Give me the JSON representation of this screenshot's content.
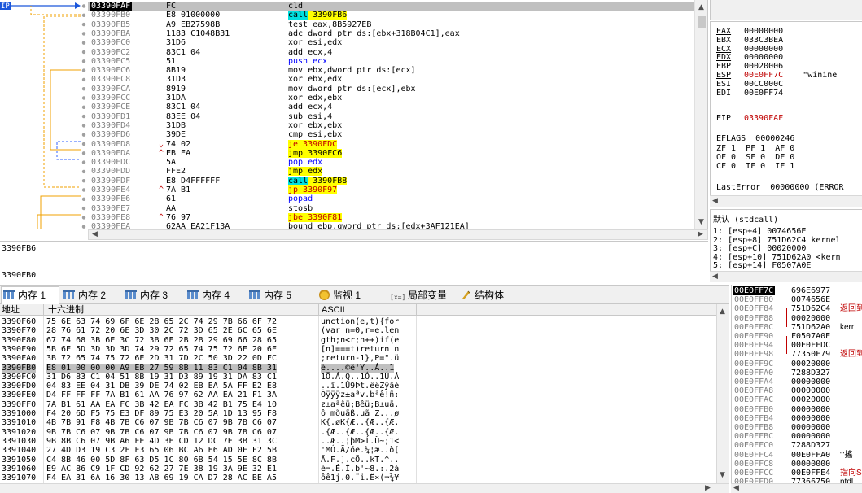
{
  "disasm": {
    "ip_label": "IP",
    "rows": [
      {
        "addr": "03390FAF",
        "arrow": "",
        "bytes": "FC",
        "asm": [
          {
            "t": "cld",
            "c": "mn"
          }
        ],
        "selected": true
      },
      {
        "addr": "03390FB0",
        "arrow": "",
        "bytes": "E8 01000000",
        "asm": [
          {
            "t": "call",
            "c": "call"
          },
          {
            "t": " 3390FB6",
            "c": "callt"
          }
        ],
        "selected": false
      },
      {
        "addr": "03390FB5",
        "arrow": "",
        "bytes": "A9 EB27598B",
        "asm": [
          {
            "t": "test eax,8B5927EB",
            "c": "mn"
          }
        ]
      },
      {
        "addr": "03390FBA",
        "arrow": "",
        "bytes": "1183 C1048B31",
        "asm": [
          {
            "t": "adc dword ptr ds:[ebx+318B04C1],eax",
            "c": "mn"
          }
        ]
      },
      {
        "addr": "03390FC0",
        "arrow": "",
        "bytes": "31D6",
        "asm": [
          {
            "t": "xor esi,edx",
            "c": "mn"
          }
        ]
      },
      {
        "addr": "03390FC2",
        "arrow": "",
        "bytes": "83C1 04",
        "asm": [
          {
            "t": "add ecx,4",
            "c": "mn"
          }
        ]
      },
      {
        "addr": "03390FC5",
        "arrow": "",
        "bytes": "51",
        "asm": [
          {
            "t": "push ecx",
            "c": "push"
          }
        ]
      },
      {
        "addr": "03390FC6",
        "arrow": "",
        "bytes": "8B19",
        "asm": [
          {
            "t": "mov ebx,dword ptr ds:[ecx]",
            "c": "mn"
          }
        ]
      },
      {
        "addr": "03390FC8",
        "arrow": "",
        "bytes": "31D3",
        "asm": [
          {
            "t": "xor ebx,edx",
            "c": "mn"
          }
        ]
      },
      {
        "addr": "03390FCA",
        "arrow": "",
        "bytes": "8919",
        "asm": [
          {
            "t": "mov dword ptr ds:[ecx],ebx",
            "c": "mn"
          }
        ]
      },
      {
        "addr": "03390FCC",
        "arrow": "",
        "bytes": "31DA",
        "asm": [
          {
            "t": "xor edx,ebx",
            "c": "mn"
          }
        ]
      },
      {
        "addr": "03390FCE",
        "arrow": "",
        "bytes": "83C1 04",
        "asm": [
          {
            "t": "add ecx,4",
            "c": "mn"
          }
        ]
      },
      {
        "addr": "03390FD1",
        "arrow": "",
        "bytes": "83EE 04",
        "asm": [
          {
            "t": "sub esi,4",
            "c": "mn"
          }
        ]
      },
      {
        "addr": "03390FD4",
        "arrow": "",
        "bytes": "31DB",
        "asm": [
          {
            "t": "xor ebx,ebx",
            "c": "mn"
          }
        ]
      },
      {
        "addr": "03390FD6",
        "arrow": "",
        "bytes": "39DE",
        "asm": [
          {
            "t": "cmp esi,ebx",
            "c": "mn"
          }
        ]
      },
      {
        "addr": "03390FD8",
        "arrow": "⌄",
        "bytes": "74 02",
        "asm": [
          {
            "t": "je 3390FDC",
            "c": "cond"
          }
        ]
      },
      {
        "addr": "03390FDA",
        "arrow": "^",
        "bytes": "EB EA",
        "asm": [
          {
            "t": "jmp 3390FC6",
            "c": "jmp"
          }
        ]
      },
      {
        "addr": "03390FDC",
        "arrow": "",
        "bytes": "5A",
        "asm": [
          {
            "t": "pop edx",
            "c": "pop"
          }
        ]
      },
      {
        "addr": "03390FDD",
        "arrow": "",
        "bytes": "FFE2",
        "asm": [
          {
            "t": "jmp edx",
            "c": "jmp"
          }
        ]
      },
      {
        "addr": "03390FDF",
        "arrow": "",
        "bytes": "E8 D4FFFFFF",
        "asm": [
          {
            "t": "call",
            "c": "call"
          },
          {
            "t": " 3390FB8",
            "c": "callt"
          }
        ]
      },
      {
        "addr": "03390FE4",
        "arrow": "^",
        "bytes": "7A B1",
        "asm": [
          {
            "t": "jp 3390F97",
            "c": "cond"
          }
        ]
      },
      {
        "addr": "03390FE6",
        "arrow": "",
        "bytes": "61",
        "asm": [
          {
            "t": "popad",
            "c": "pop"
          }
        ]
      },
      {
        "addr": "03390FE7",
        "arrow": "",
        "bytes": "AA",
        "asm": [
          {
            "t": "stosb",
            "c": "mn"
          }
        ]
      },
      {
        "addr": "03390FE8",
        "arrow": "^",
        "bytes": "76 97",
        "asm": [
          {
            "t": "jbe 3390F81",
            "c": "cond"
          }
        ]
      },
      {
        "addr": "03390FEA",
        "arrow": "",
        "bytes": "62AA EA21F13A",
        "asm": [
          {
            "t": "bound ebp,qword ptr ds:[edx+3AF121EA]",
            "c": "mn"
          }
        ]
      }
    ]
  },
  "info": {
    "line1": "3390FB6",
    "line2": "3390FB0"
  },
  "registers": {
    "rows": [
      {
        "name": "EAX",
        "value": "00000000",
        "style": "ul"
      },
      {
        "name": "EBX",
        "value": "033C3BEA",
        "style": ""
      },
      {
        "name": "ECX",
        "value": "00000000",
        "style": "ul"
      },
      {
        "name": "EDX",
        "value": "00000000",
        "style": "ul"
      },
      {
        "name": "EBP",
        "value": "00020006",
        "style": ""
      },
      {
        "name": "ESP",
        "value": "00E0FF7C",
        "style": "ulred",
        "note": "\"winine"
      },
      {
        "name": "ESI",
        "value": "00CC000C",
        "style": ""
      },
      {
        "name": "EDI",
        "value": "00E0FF74",
        "style": ""
      }
    ],
    "eip_name": "EIP",
    "eip_value": "03390FAF",
    "eflags_name": "EFLAGS",
    "eflags_value": "00000246",
    "flags": [
      "ZF 1  PF 1  AF 0",
      "OF 0  SF 0  DF 0",
      "CF 0  TF 0  IF 1"
    ],
    "lasterror": "LastError  00000000 (ERROR"
  },
  "callstack": {
    "title": "默认 (stdcall)",
    "rows": [
      "1: [esp+4] 0074656E",
      "2: [esp+8] 751D62C4 kernel",
      "3: [esp+C] 00020000",
      "4: [esp+10] 751D62A0 <kern",
      "5: [esp+14] F0507A0E"
    ]
  },
  "tabs": [
    {
      "label": "内存 1",
      "icon": "mem",
      "active": true
    },
    {
      "label": "内存 2",
      "icon": "mem"
    },
    {
      "label": "内存 3",
      "icon": "mem"
    },
    {
      "label": "内存 4",
      "icon": "mem"
    },
    {
      "label": "内存 5",
      "icon": "mem"
    },
    {
      "label": "监视 1",
      "icon": "watch"
    },
    {
      "label": "局部变量",
      "icon": "var",
      "iconText": "[x=]"
    },
    {
      "label": "结构体",
      "icon": "struct"
    }
  ],
  "dump": {
    "col_addr": "地址",
    "col_hex": "十六进制",
    "col_ascii": "ASCII",
    "rows": [
      {
        "addr": "3390F60",
        "hex": "75 6E 63 74 69 6F 6E 28 65 2C 74 29 7B 66 6F 72",
        "ascii": "unction(e,t){for"
      },
      {
        "addr": "3390F70",
        "hex": "28 76 61 72 20 6E 3D 30 2C 72 3D 65 2E 6C 65 6E",
        "ascii": "(var n=0,r=e.len"
      },
      {
        "addr": "3390F80",
        "hex": "67 74 68 3B 6E 3C 72 3B 6E 2B 2B 29 69 66 28 65",
        "ascii": "gth;n<r;n++)if(e"
      },
      {
        "addr": "3390F90",
        "hex": "5B 6E 5D 3D 3D 3D 74 29 72 65 74 75 72 6E 20 6E",
        "ascii": "[n]===t)return n"
      },
      {
        "addr": "3390FA0",
        "hex": "3B 72 65 74 75 72 6E 2D 31 7D 2C 50 3D 22 0D FC",
        "ascii": ";return-1},P=\".ü"
      },
      {
        "addr": "3390FB0",
        "hex": "E8 01 00 00 00 A9 EB 27 59 8B 11 83 C1 04 8B 31",
        "ascii": "è....©ë'Y..Á..1",
        "selected": true
      },
      {
        "addr": "3390FC0",
        "hex": "31 D6 83 C1 04 51 8B 19 31 D3 89 19 31 DA 83 C1",
        "ascii": "1Ö.Á.Q..1Ó..1Ú.Á"
      },
      {
        "addr": "3390FD0",
        "hex": "04 83 EE 04 31 DB 39 DE 74 02 EB EA 5A FF E2 E8",
        "ascii": "..î.1Û9Þt.ëêZÿâè"
      },
      {
        "addr": "3390FE0",
        "hex": "D4 FF FF FF 7A B1 61 AA 76 97 62 AA EA 21 F1 3A",
        "ascii": "Ôÿÿÿz±aªv.bªê!ñ:"
      },
      {
        "addr": "3390FF0",
        "hex": "7A B1 61 AA EA FC 3B 42 EA FC 3B 42 B1 75 E4 10",
        "ascii": "z±aªêü;Bêü;B±uä."
      },
      {
        "addr": "3391000",
        "hex": "F4 20 6D F5 75 E3 DF 89 75 E3 20 5A 1D 13 95 F8",
        "ascii": "ô mõuãß.uã Z...ø"
      },
      {
        "addr": "3391010",
        "hex": "4B 7B 91 F8 4B 7B C6 07 9B 7B C6 07 9B 7B C6 07",
        "ascii": "K{.øK{Æ..{Æ..{Æ."
      },
      {
        "addr": "3391020",
        "hex": "9B 7B C6 07 9B 7B C6 07 9B 7B C6 07 9B 7B C6 07",
        "ascii": ".{Æ..{Æ..{Æ..{Æ."
      },
      {
        "addr": "3391030",
        "hex": "9B 8B C6 07 9B A6 FE 4D 3E CD 12 DC 7E 3B 31 3C",
        "ascii": "..Æ..¦þM>Í.Ü~;1<"
      },
      {
        "addr": "3391040",
        "hex": "27 4D D3 19 C3 2F F3 65 06 BC A6 E6 AD 0F F2 5B",
        "ascii": "'MÓ.Ã/óe.¼¦æ..ò["
      },
      {
        "addr": "3391050",
        "hex": "C4 8B 46 00 5D 8F 63 D5 1C 80 6B 54 15 5E 8C 8B",
        "ascii": "Ä.F.].cÕ..kT.^.."
      },
      {
        "addr": "3391060",
        "hex": "E9 AC 86 C9 1F CD 92 62 27 7E 38 19 3A 9E 32 E1",
        "ascii": "é¬.É.Í.b'~8.:.2á"
      },
      {
        "addr": "3391070",
        "hex": "F4 EA 31 6A 16 30 13 A8 69 19 CA D7 28 AC BE A5",
        "ascii": "ôê1j.0.¨i.Ê×(¬¾¥"
      }
    ]
  },
  "stack": {
    "rows": [
      {
        "addr": "00E0FF7C",
        "val": "696E6977",
        "cmt": "",
        "top": true
      },
      {
        "addr": "00E0FF80",
        "val": "0074656E",
        "cmt": ""
      },
      {
        "addr": "00E0FF84",
        "val": "751D62C4",
        "cmt": "返回到"
      },
      {
        "addr": "00E0FF88",
        "val": "00020000",
        "cmt": ""
      },
      {
        "addr": "00E0FF8C",
        "val": "751D62A0",
        "cmt": "kerr",
        "k": true
      },
      {
        "addr": "00E0FF90",
        "val": "F0507A0E",
        "cmt": ""
      },
      {
        "addr": "00E0FF94",
        "val": "00E0FFDC",
        "cmt": ""
      },
      {
        "addr": "00E0FF98",
        "val": "77350F79",
        "cmt": "返回到"
      },
      {
        "addr": "00E0FF9C",
        "val": "00020000",
        "cmt": ""
      },
      {
        "addr": "00E0FFA0",
        "val": "7288D327",
        "cmt": ""
      },
      {
        "addr": "00E0FFA4",
        "val": "00000000",
        "cmt": ""
      },
      {
        "addr": "00E0FFA8",
        "val": "00000000",
        "cmt": ""
      },
      {
        "addr": "00E0FFAC",
        "val": "00020000",
        "cmt": ""
      },
      {
        "addr": "00E0FFB0",
        "val": "00000000",
        "cmt": ""
      },
      {
        "addr": "00E0FFB4",
        "val": "00000000",
        "cmt": ""
      },
      {
        "addr": "00E0FFB8",
        "val": "00000000",
        "cmt": ""
      },
      {
        "addr": "00E0FFBC",
        "val": "00000000",
        "cmt": ""
      },
      {
        "addr": "00E0FFC0",
        "val": "7288D327",
        "cmt": ""
      },
      {
        "addr": "00E0FFC4",
        "val": "00E0FFA0",
        "cmt": "\"'搖",
        "k": true
      },
      {
        "addr": "00E0FFC8",
        "val": "00000000",
        "cmt": ""
      },
      {
        "addr": "00E0FFCC",
        "val": "00E0FFE4",
        "cmt": "指向S"
      },
      {
        "addr": "00E0FFD0",
        "val": "77366750",
        "cmt": "ntdl",
        "k": true
      }
    ]
  },
  "colors": {
    "highlight_red": "#c00000",
    "call_bg": "#00e0e0",
    "jmp_bg": "#ffff00",
    "ip_bg": "#1a56db",
    "jump_blue": "#3060ff",
    "jump_orange": "#f0a000"
  }
}
